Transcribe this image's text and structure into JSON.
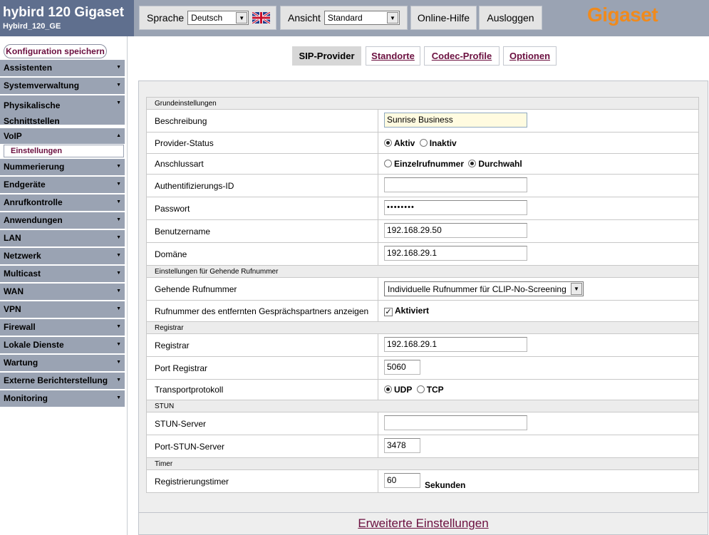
{
  "header": {
    "title": "hybird 120 Gigaset",
    "device_name": "Hybird_120_GE",
    "language_label": "Sprache",
    "language_value": "Deutsch",
    "view_label": "Ansicht",
    "view_value": "Standard",
    "help_label": "Online-Hilfe",
    "logout_label": "Ausloggen",
    "logo_text": "Gigaset",
    "logo_color": "#f08a1c"
  },
  "sidebar": {
    "save_label": "Konfiguration speichern",
    "items": [
      {
        "label": "Assistenten"
      },
      {
        "label": "Systemverwaltung"
      },
      {
        "label": "Physikalische Schnittstellen"
      },
      {
        "label": "VoIP"
      },
      {
        "label": "Nummerierung"
      },
      {
        "label": "Endgeräte"
      },
      {
        "label": "Anrufkontrolle"
      },
      {
        "label": "Anwendungen"
      },
      {
        "label": "LAN"
      },
      {
        "label": "Netzwerk"
      },
      {
        "label": "Multicast"
      },
      {
        "label": "WAN"
      },
      {
        "label": "VPN"
      },
      {
        "label": "Firewall"
      },
      {
        "label": "Lokale Dienste"
      },
      {
        "label": "Wartung"
      },
      {
        "label": "Externe Berichterstellung"
      },
      {
        "label": "Monitoring"
      }
    ],
    "sub_active": "Einstellungen"
  },
  "tabs": [
    {
      "label": "SIP-Provider",
      "active": true
    },
    {
      "label": "Standorte",
      "active": false
    },
    {
      "label": "Codec-Profile",
      "active": false
    },
    {
      "label": "Optionen",
      "active": false
    }
  ],
  "form": {
    "sec_basic": "Grundeinstellungen",
    "desc_label": "Beschreibung",
    "desc_value": "Sunrise Business",
    "status_label": "Provider-Status",
    "status_opt1": "Aktiv",
    "status_opt2": "Inaktiv",
    "conn_label": "Anschlussart",
    "conn_opt1": "Einzelrufnummer",
    "conn_opt2": "Durchwahl",
    "auth_label": "Authentifizierungs-ID",
    "auth_value": "",
    "pass_label": "Passwort",
    "pass_value": "••••••••",
    "user_label": "Benutzername",
    "user_value": "192.168.29.50",
    "domain_label": "Domäne",
    "domain_value": "192.168.29.1",
    "sec_outgoing": "Einstellungen für Gehende Rufnummer",
    "outgoing_label": "Gehende Rufnummer",
    "outgoing_value": "Individuelle Rufnummer für CLIP-No-Screening",
    "show_remote_label": "Rufnummer des entfernten Gesprächspartners anzeigen",
    "show_remote_value": "Aktiviert",
    "sec_registrar": "Registrar",
    "registrar_label": "Registrar",
    "registrar_value": "192.168.29.1",
    "port_reg_label": "Port Registrar",
    "port_reg_value": "5060",
    "transport_label": "Transportprotokoll",
    "transport_opt1": "UDP",
    "transport_opt2": "TCP",
    "sec_stun": "STUN",
    "stun_label": "STUN-Server",
    "stun_value": "",
    "port_stun_label": "Port-STUN-Server",
    "port_stun_value": "3478",
    "sec_timer": "Timer",
    "timer_label": "Registrierungstimer",
    "timer_value": "60",
    "timer_unit": "Sekunden",
    "advanced_label": "Erweiterte Einstellungen"
  }
}
